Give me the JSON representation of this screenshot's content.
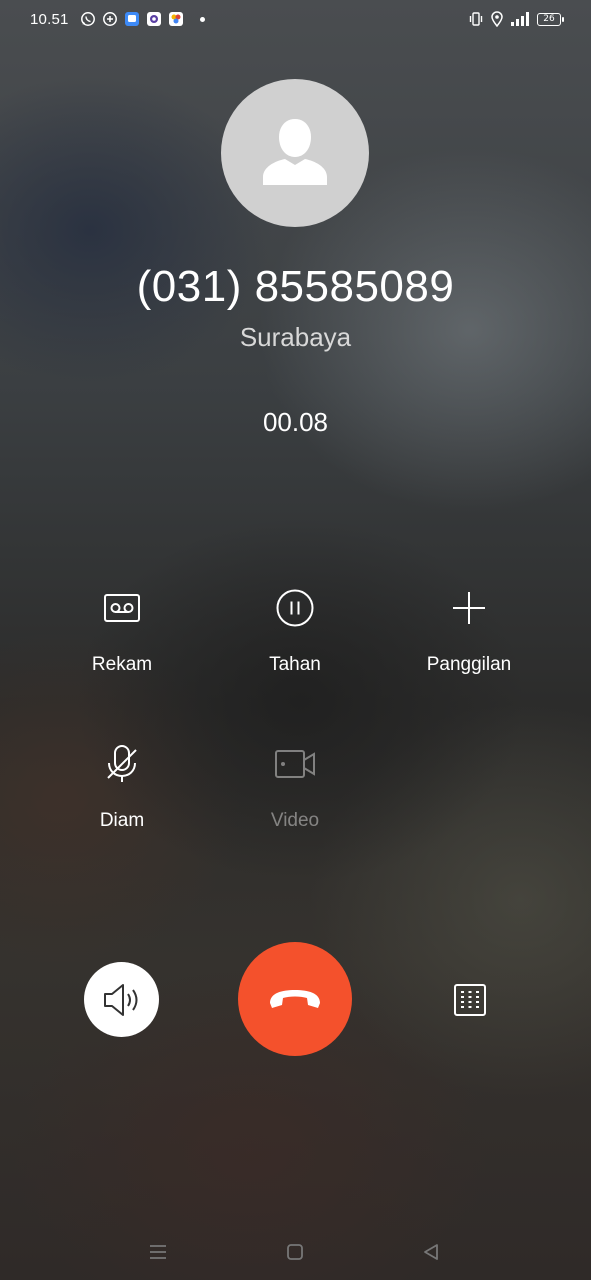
{
  "status_bar": {
    "time": "10.51",
    "battery": "26",
    "app_icons": [
      "whatsapp-icon",
      "chat-icon",
      "messages-app-icon",
      "camera-app-icon",
      "photos-app-icon"
    ]
  },
  "call": {
    "number": "(031) 85585089",
    "location": "Surabaya",
    "duration": "00.08"
  },
  "actions": [
    {
      "label": "Rekam",
      "icon": "voicemail-record-icon",
      "enabled": true
    },
    {
      "label": "Tahan",
      "icon": "pause-circle-icon",
      "enabled": true
    },
    {
      "label": "Panggilan",
      "icon": "plus-icon",
      "enabled": true
    },
    {
      "label": "Diam",
      "icon": "mic-off-icon",
      "enabled": true
    },
    {
      "label": "Video",
      "icon": "video-camera-icon",
      "enabled": false
    }
  ],
  "bottom_controls": {
    "speaker": "speaker-icon",
    "end_call": "end-call-icon",
    "keypad": "dialpad-icon"
  },
  "colors": {
    "end_call": "#f4512c",
    "avatar_bg": "#d0d0d0",
    "text": "#ffffff"
  },
  "nav": [
    "menu-icon",
    "home-icon",
    "back-icon"
  ]
}
